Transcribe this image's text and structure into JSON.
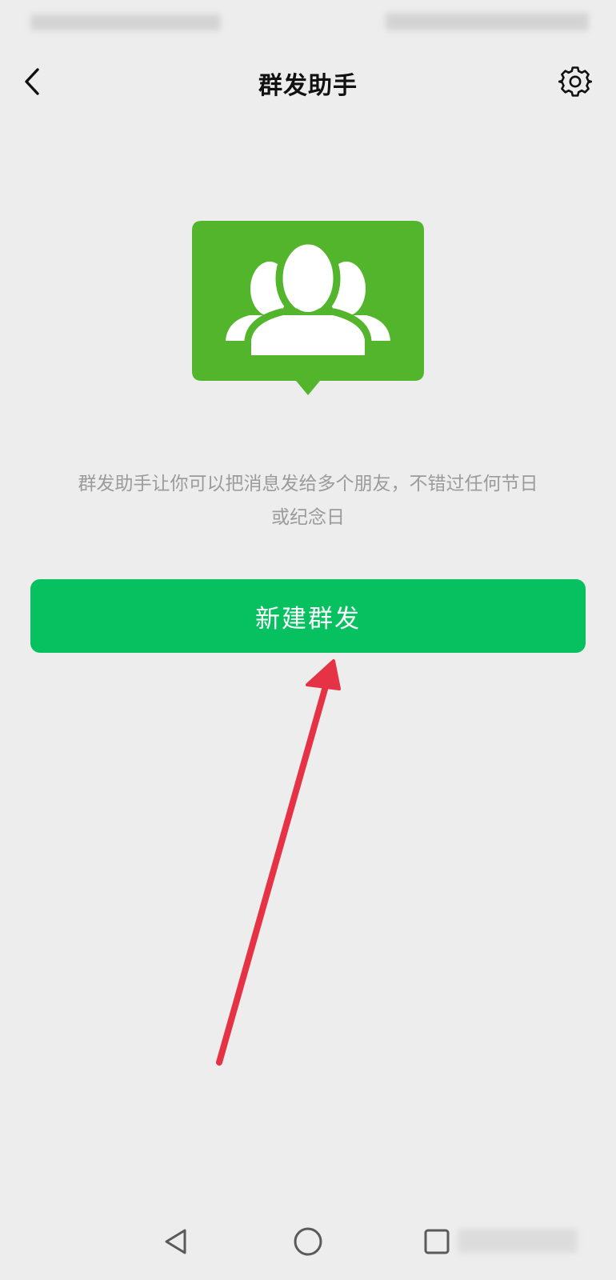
{
  "nav": {
    "title": "群发助手"
  },
  "main": {
    "description_line1": "群发助手让你可以把消息发给多个朋友，不错过任何节日",
    "description_line2": "或纪念日",
    "new_button_label": "新建群发"
  },
  "icons": {
    "back": "chevron-left-icon",
    "settings": "gear-icon",
    "hero": "group-chat-icon",
    "sys_back": "triangle-back-icon",
    "sys_home": "circle-home-icon",
    "sys_recents": "square-recents-icon"
  },
  "colors": {
    "background": "#ededed",
    "button": "#07c160",
    "hero_icon": "#53b52c",
    "annotation_arrow": "#e53345",
    "description_text": "#9b9b9b"
  }
}
